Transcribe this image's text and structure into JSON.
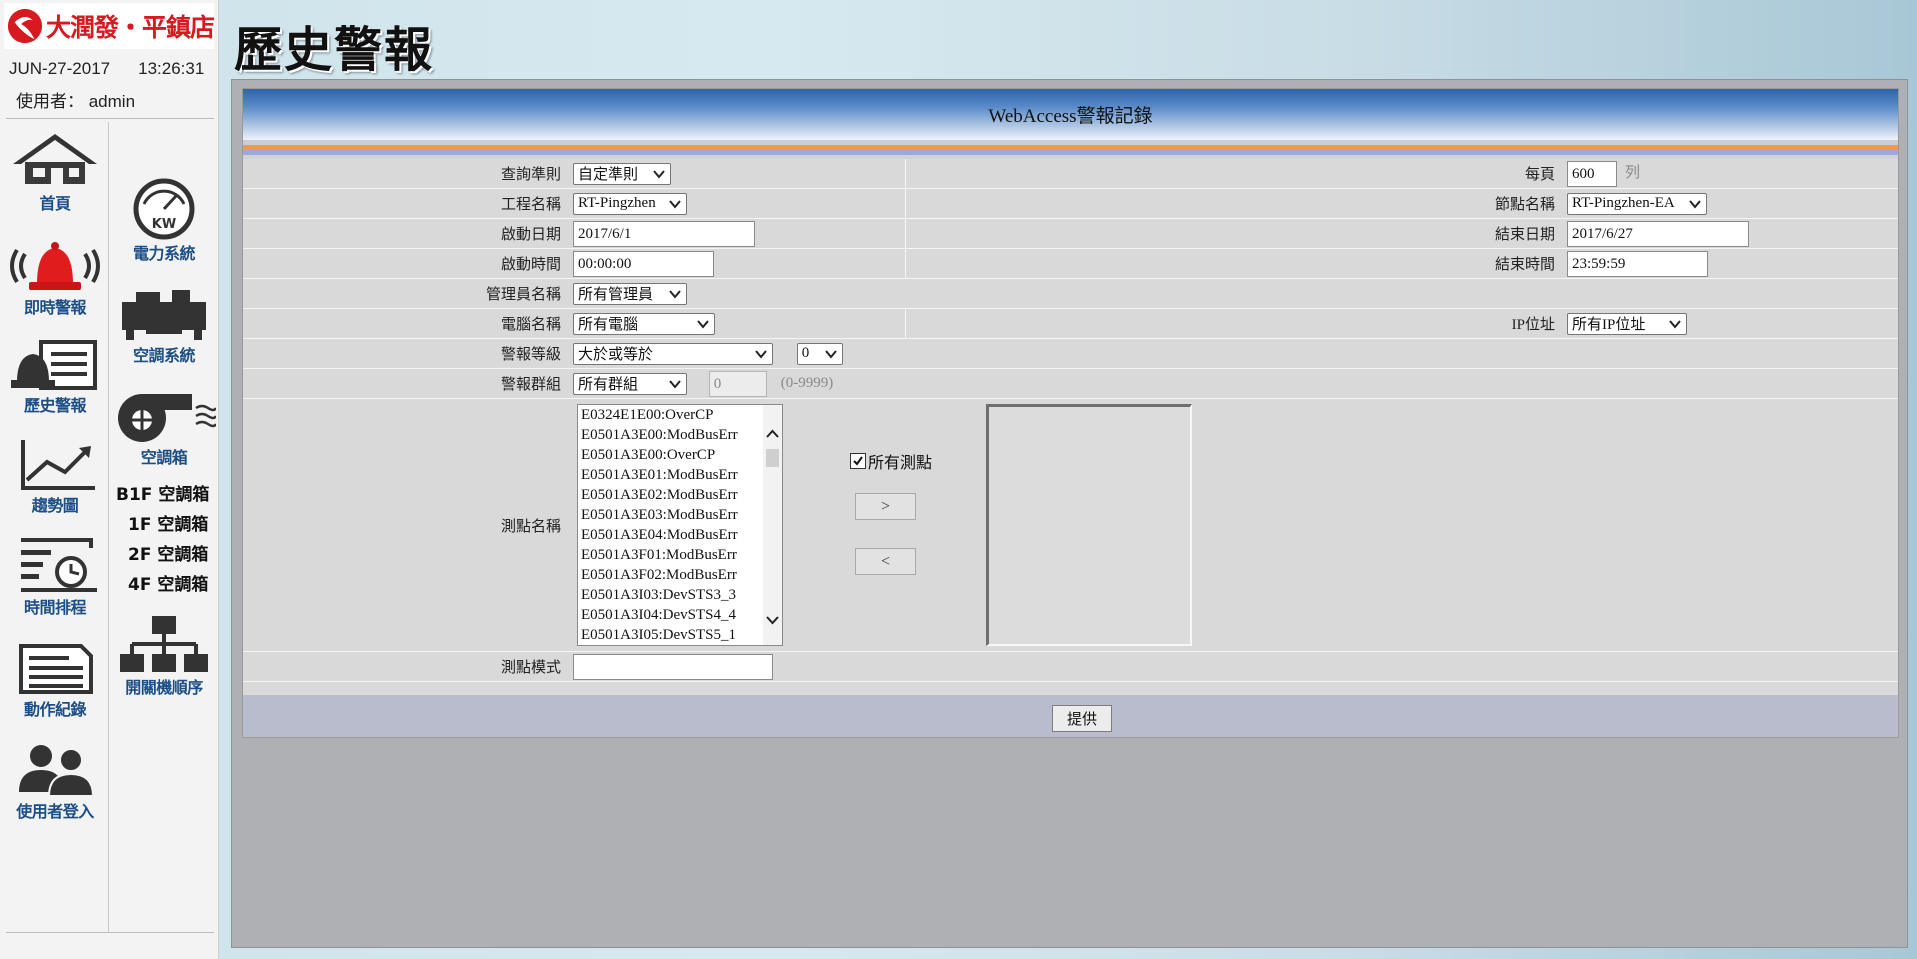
{
  "brand": {
    "name": "大潤發・平鎮店"
  },
  "session": {
    "date": "JUN-27-2017",
    "time": "13:26:31",
    "user_label": "使用者： admin"
  },
  "nav": {
    "left": [
      "首頁",
      "即時警報",
      "歷史警報",
      "趨勢圖",
      "時間排程",
      "動作紀錄",
      "使用者登入"
    ],
    "right": [
      "電力系統",
      "空調系統",
      "空調箱",
      "開關機順序"
    ],
    "sub_links": [
      "B1F 空調箱",
      "1F 空調箱",
      "2F 空調箱",
      "4F 空調箱"
    ]
  },
  "page": {
    "title": "歷史警報"
  },
  "form": {
    "banner": "WebAccess警報記錄",
    "query_rule": {
      "label": "查詢準則",
      "value": "自定準則"
    },
    "per_page": {
      "label": "每頁",
      "value": "600",
      "unit": "列"
    },
    "project": {
      "label": "工程名稱",
      "value": "RT-Pingzhen"
    },
    "node": {
      "label": "節點名稱",
      "value": "RT-Pingzhen-EA"
    },
    "start_date": {
      "label": "啟動日期",
      "value": "2017/6/1"
    },
    "end_date": {
      "label": "結束日期",
      "value": "2017/6/27"
    },
    "start_time": {
      "label": "啟動時間",
      "value": "00:00:00"
    },
    "end_time": {
      "label": "結束時間",
      "value": "23:59:59"
    },
    "admin": {
      "label": "管理員名稱",
      "value": "所有管理員"
    },
    "computer": {
      "label": "電腦名稱",
      "value": "所有電腦"
    },
    "ip": {
      "label": "IP位址",
      "value": "所有IP位址"
    },
    "alarm_level": {
      "label": "警報等級",
      "operator": "大於或等於",
      "value": "0"
    },
    "alarm_group": {
      "label": "警報群組",
      "value": "所有群組",
      "number": "0",
      "range": "(0-9999)"
    },
    "tags": {
      "label": "測點名稱",
      "items": [
        "E0324E1E00:OverCP",
        "E0501A3E00:ModBusErr",
        "E0501A3E00:OverCP",
        "E0501A3E01:ModBusErr",
        "E0501A3E02:ModBusErr",
        "E0501A3E03:ModBusErr",
        "E0501A3E04:ModBusErr",
        "E0501A3F01:ModBusErr",
        "E0501A3F02:ModBusErr",
        "E0501A3I03:DevSTS3_3",
        "E0501A3I04:DevSTS4_4",
        "E0501A3I05:DevSTS5_1"
      ],
      "all_label": "所有測點",
      "all_checked": true,
      "add_button": ">",
      "remove_button": "<"
    },
    "tag_pattern": {
      "label": "測點模式",
      "value": ""
    },
    "submit": "提供"
  },
  "colors": {
    "brand_red": "#d71920",
    "nav_blue": "#1d4f86",
    "banner_blue": "#2c64ab"
  }
}
